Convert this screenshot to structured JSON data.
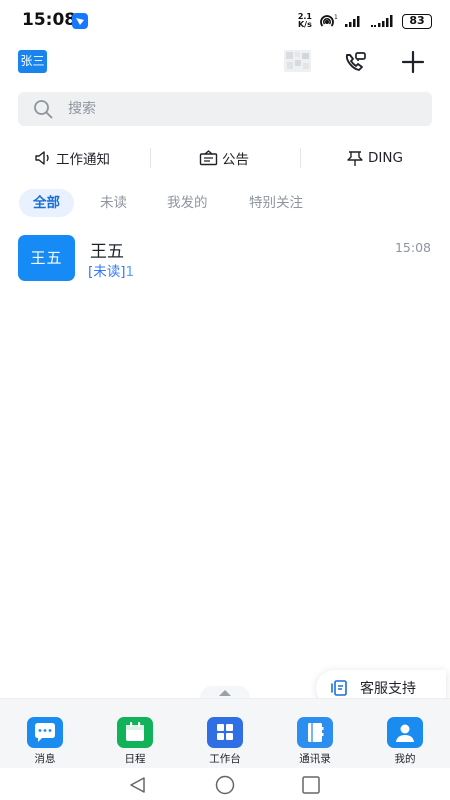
{
  "status_bar": {
    "time": "15:08",
    "speed_value": "2.1",
    "speed_unit": "K/s",
    "battery": "83"
  },
  "header": {
    "avatar_text": "张三",
    "icons": [
      "qr-blur",
      "phone-icon",
      "plus-icon"
    ]
  },
  "search": {
    "placeholder": "搜索"
  },
  "shortcuts": [
    {
      "label": "工作通知",
      "icon": "speaker-icon"
    },
    {
      "label": "公告",
      "icon": "announcement-icon"
    },
    {
      "label": "DING",
      "icon": "pin-icon"
    }
  ],
  "tabs": [
    {
      "label": "全部",
      "active": true
    },
    {
      "label": "未读",
      "active": false
    },
    {
      "label": "我发的",
      "active": false
    },
    {
      "label": "特别关注",
      "active": false
    }
  ],
  "conversations": [
    {
      "avatar_text": "王五",
      "name": "王五",
      "preview_tag": "[未读]",
      "preview_text": "1",
      "time": "15:08"
    }
  ],
  "customer_service": {
    "label": "客服支持"
  },
  "bottom_nav": [
    {
      "label": "消息",
      "color": "#1a8cf0",
      "icon": "chat-icon"
    },
    {
      "label": "日程",
      "color": "#12b25a",
      "icon": "calendar-icon"
    },
    {
      "label": "工作台",
      "color": "#2f6fe3",
      "icon": "grid-icon"
    },
    {
      "label": "通讯录",
      "color": "#2c8ff0",
      "icon": "contacts-icon"
    },
    {
      "label": "我的",
      "color": "#1a8cf0",
      "icon": "person-icon"
    }
  ],
  "colors": {
    "accent": "#1a6fd6",
    "brand_blue": "#168bf5",
    "unread_blue": "#3377ff"
  }
}
